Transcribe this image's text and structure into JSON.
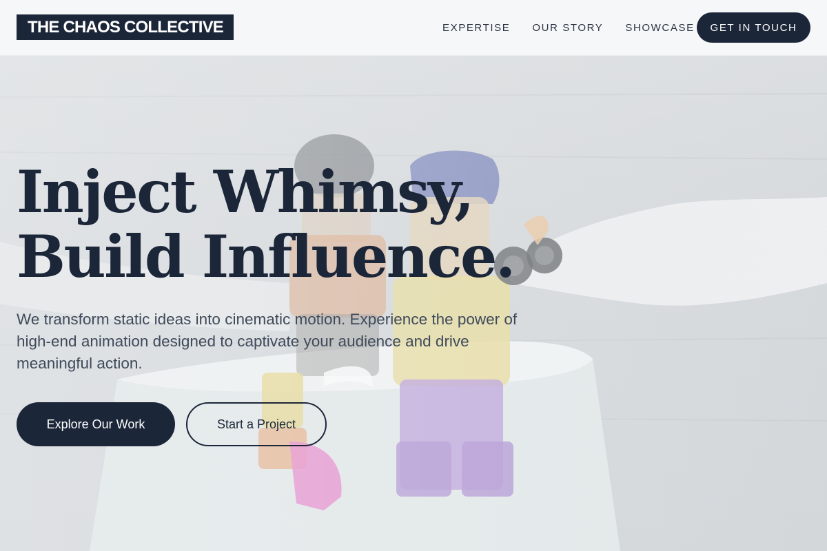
{
  "brand": {
    "name": "THE CHAOS COLLECTIVE"
  },
  "nav": {
    "links": [
      "EXPERTISE",
      "OUR STORY",
      "SHOWCASE"
    ],
    "cta_label": "GET IN TOUCH"
  },
  "hero": {
    "headline_line1": "Inject Whimsy,",
    "headline_line2": "Build Influence.",
    "subtext": "We transform static ideas into cinematic motion. Experience the power of high-end animation designed to captivate your audience and drive meaningful action.",
    "primary_button": "Explore Our Work",
    "secondary_button": "Start a Project"
  },
  "colors": {
    "brand_navy": "#1c2639",
    "nav_background": "#f6f7f8",
    "body_text": "#3f4a5a"
  },
  "icons": {
    "hero_background": "lego-figures-paper-boat-photo"
  }
}
